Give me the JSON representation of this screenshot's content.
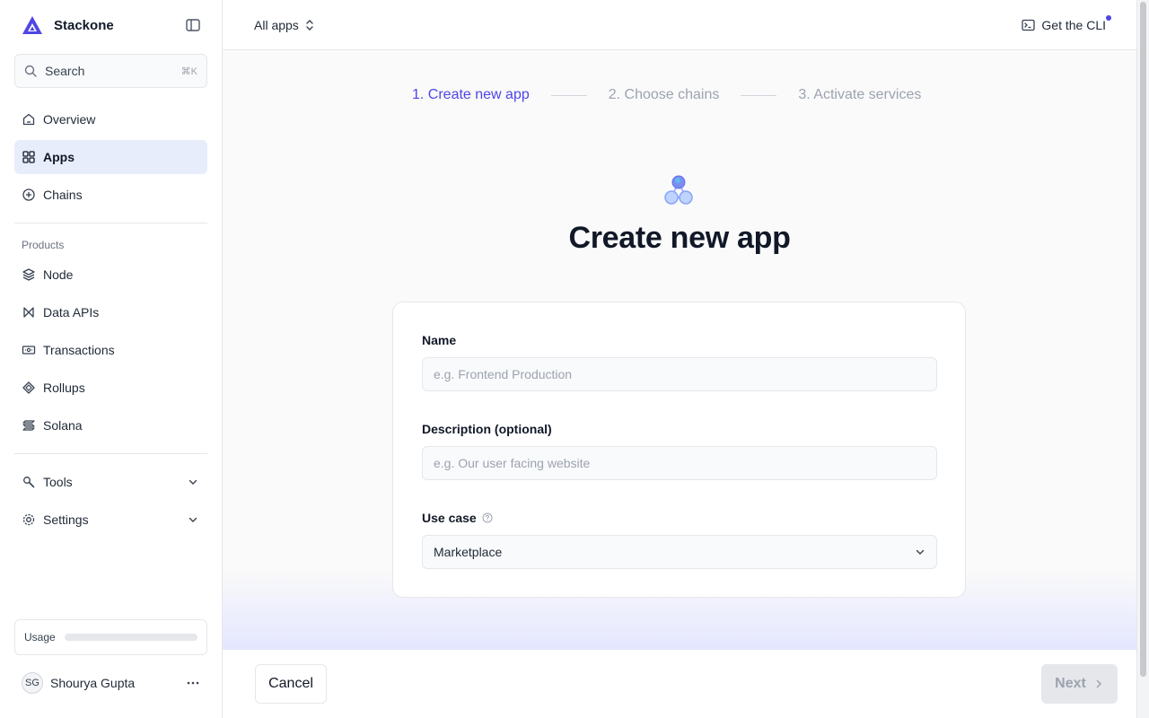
{
  "brand": {
    "name": "Stackone"
  },
  "search": {
    "placeholder": "Search",
    "shortcut": "⌘K"
  },
  "sidebar": {
    "primary": [
      {
        "label": "Overview",
        "icon": "home-icon",
        "active": false
      },
      {
        "label": "Apps",
        "icon": "grid-icon",
        "active": true
      },
      {
        "label": "Chains",
        "icon": "plus-circle-icon",
        "active": false
      }
    ],
    "products_label": "Products",
    "products": [
      {
        "label": "Node",
        "icon": "cube-icon"
      },
      {
        "label": "Data APIs",
        "icon": "data-icon"
      },
      {
        "label": "Transactions",
        "icon": "ticket-icon"
      },
      {
        "label": "Rollups",
        "icon": "layers-icon"
      },
      {
        "label": "Solana",
        "icon": "solana-icon"
      }
    ],
    "tools": {
      "label": "Tools",
      "icon": "tools-icon"
    },
    "settings": {
      "label": "Settings",
      "icon": "gear-icon"
    },
    "usage": {
      "label": "Usage",
      "progress": 0
    },
    "user": {
      "initials": "SG",
      "name": "Shourya Gupta"
    }
  },
  "topbar": {
    "app_switch_label": "All apps",
    "cli_label": "Get the CLI"
  },
  "steps": [
    {
      "label": "1. Create new app",
      "current": true
    },
    {
      "label": "2. Choose chains",
      "current": false
    },
    {
      "label": "3. Activate services",
      "current": false
    }
  ],
  "page": {
    "title": "Create new app"
  },
  "form": {
    "name": {
      "label": "Name",
      "placeholder": "e.g. Frontend Production",
      "value": ""
    },
    "description": {
      "label": "Description (optional)",
      "placeholder": "e.g. Our user facing website",
      "value": ""
    },
    "use_case": {
      "label": "Use case",
      "value": "Marketplace"
    }
  },
  "footer": {
    "cancel_label": "Cancel",
    "next_label": "Next"
  },
  "colors": {
    "accent": "#4f46e5",
    "active_nav_bg": "#e8edfb",
    "muted_text": "#9ca3af"
  }
}
